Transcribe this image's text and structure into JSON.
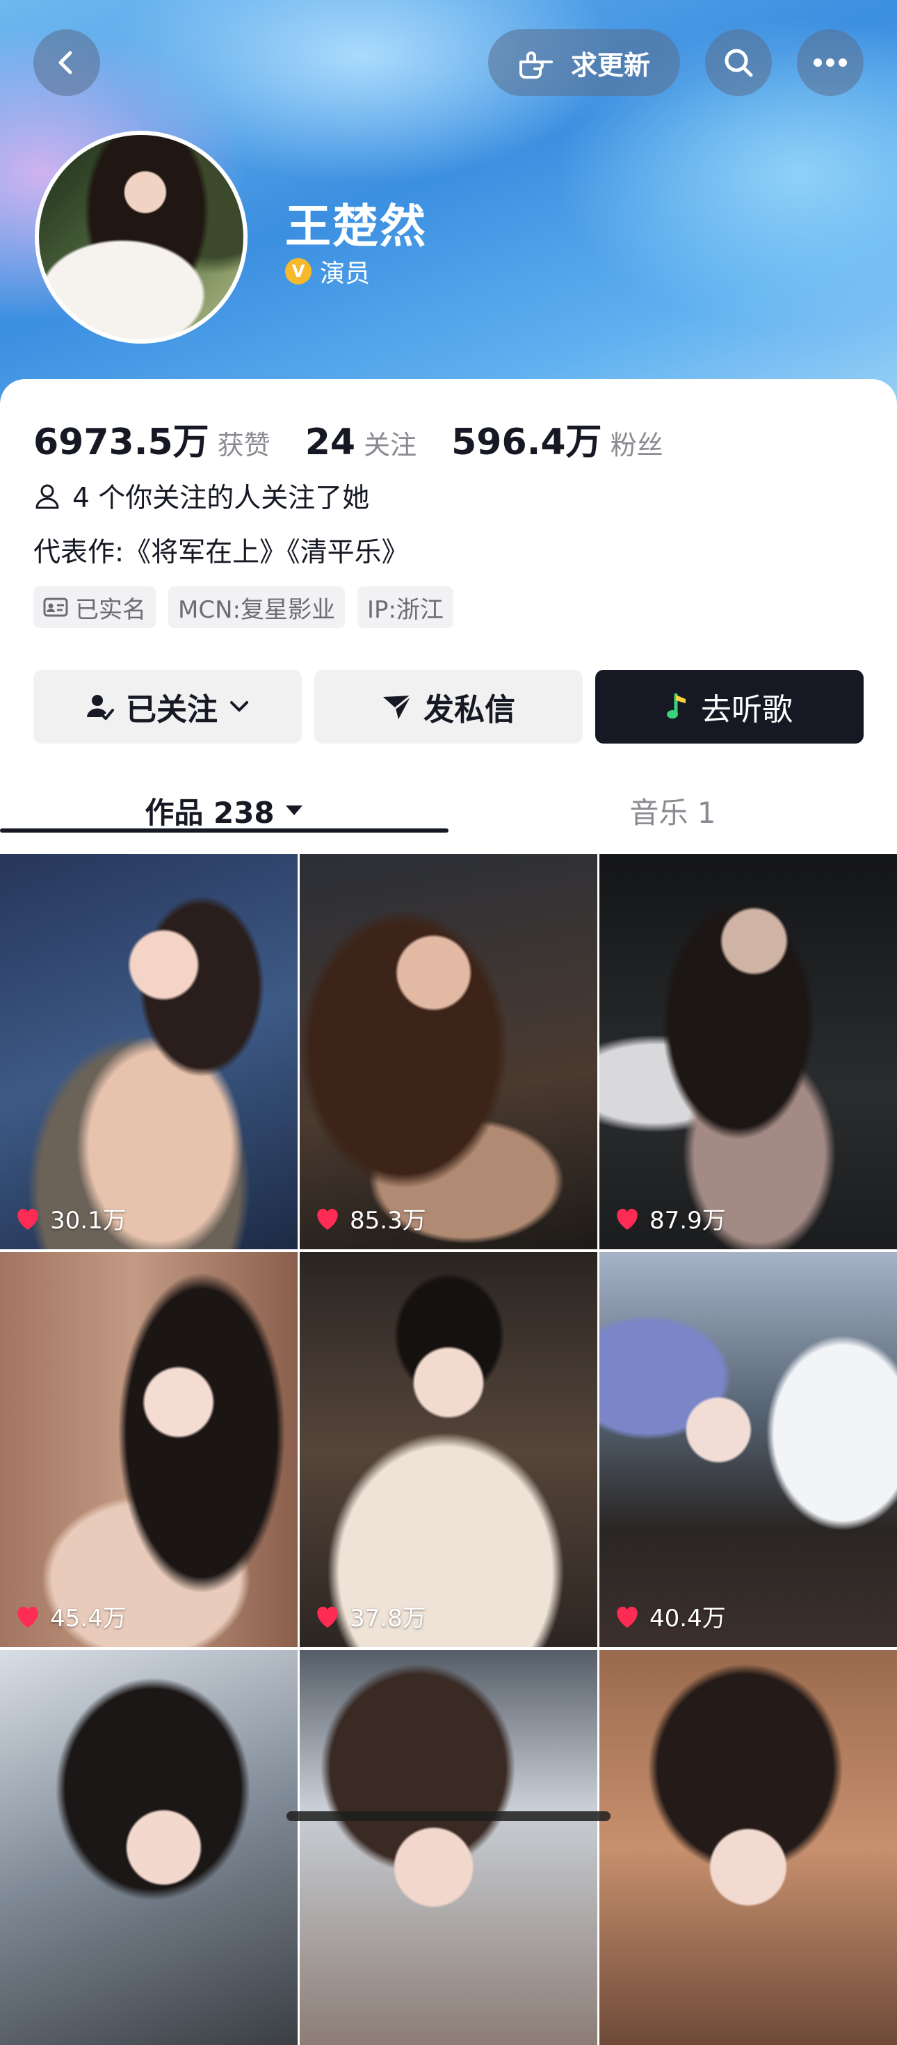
{
  "header": {
    "update_label": "求更新",
    "name": "王楚然",
    "verify_badge": "V",
    "verify_label": "演员"
  },
  "stats": [
    {
      "value": "6973.5万",
      "label": "获赞"
    },
    {
      "value": "24",
      "label": "关注"
    },
    {
      "value": "596.4万",
      "label": "粉丝"
    }
  ],
  "mutual": "4 个你关注的人关注了她",
  "bio": "代表作:《将军在上》《清平乐》",
  "tags": {
    "verified": "已实名",
    "mcn": "MCN:复星影业",
    "ip": "IP:浙江"
  },
  "actions": {
    "follow": "已关注",
    "message": "发私信",
    "music": "去听歌"
  },
  "tabs": {
    "works": "作品 238",
    "music": "音乐 1"
  },
  "videos": [
    {
      "likes": "30.1万"
    },
    {
      "likes": "85.3万"
    },
    {
      "likes": "87.9万"
    },
    {
      "likes": "45.4万"
    },
    {
      "likes": "37.8万"
    },
    {
      "likes": "40.4万"
    },
    {
      "likes": ""
    },
    {
      "likes": ""
    },
    {
      "likes": ""
    }
  ],
  "colors": {
    "like_heart": "#fe2c55",
    "primary_dark": "#161823",
    "verify_gold": "#f5b92a"
  }
}
